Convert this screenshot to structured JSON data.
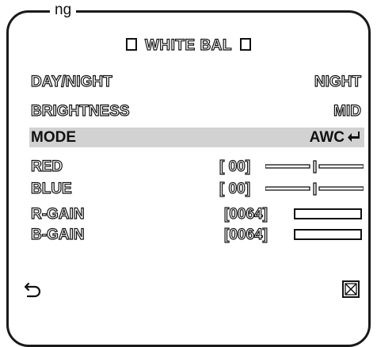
{
  "top_caption": "ng",
  "title": "WHITE BAL",
  "rows": [
    {
      "label": "DAY/NIGHT",
      "value": "NIGHT"
    },
    {
      "label": "BRIGHTNESS",
      "value": "MID"
    },
    {
      "label": "MODE",
      "value": "AWC"
    },
    {
      "label": "RED",
      "value": "[ 00]"
    },
    {
      "label": "BLUE",
      "value": "[ 00]"
    },
    {
      "label": "R-GAIN",
      "value": "[0064]"
    },
    {
      "label": "B-GAIN",
      "value": "[0064]"
    }
  ],
  "icons": {
    "back": "back-arrow-icon",
    "exit": "exit-box-icon",
    "enter": "enter-icon",
    "title_marker": "square-icon"
  },
  "sliders": {
    "red_level": 0.5,
    "blue_level": 0.5
  },
  "colors": {
    "selected_row": "#d2d2d2",
    "text": "#111111",
    "background": "#ffffff"
  }
}
